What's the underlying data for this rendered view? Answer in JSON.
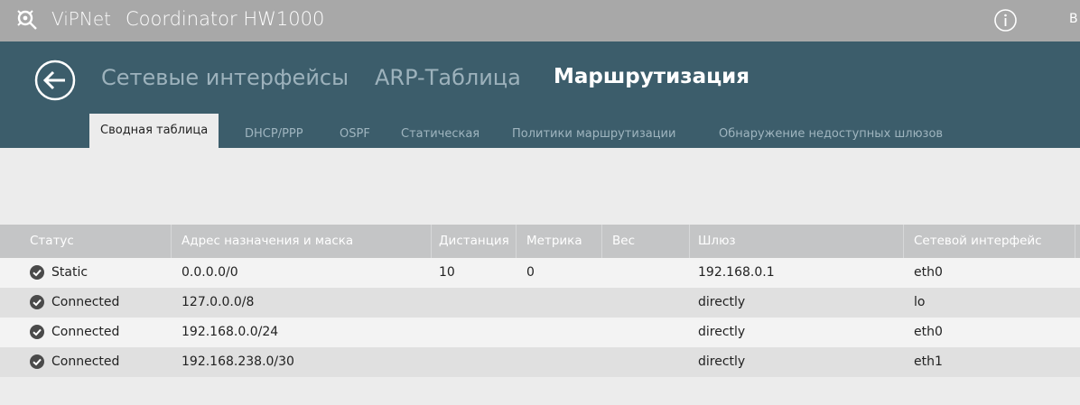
{
  "app": {
    "brand": "ViPNet",
    "product": "Coordinator HW1000",
    "user_initial": "B"
  },
  "header": {
    "main_tabs": [
      {
        "label": "Сетевые интерфейсы"
      },
      {
        "label": "ARP-Таблица"
      },
      {
        "label": "Маршрутизация"
      }
    ],
    "active_main_tab": "Маршрутизация",
    "sub_tabs": [
      {
        "label": "Сводная таблица"
      },
      {
        "label": "DHCP/PPP"
      },
      {
        "label": "OSPF"
      },
      {
        "label": "Статическая"
      },
      {
        "label": "Политики маршрутизации"
      },
      {
        "label": "Обнаружение недоступных шлюзов"
      }
    ],
    "active_sub_tab": "Сводная таблица"
  },
  "table": {
    "columns": [
      "Статус",
      "Адрес назначения и маска",
      "Дистанция",
      "Метрика",
      "Вес",
      "Шлюз",
      "Сетевой интерфейс"
    ],
    "rows": [
      {
        "status": "Static",
        "destination": "0.0.0.0/0",
        "distance": "10",
        "metric": "0",
        "weight": "",
        "gateway": "192.168.0.1",
        "interface": "eth0"
      },
      {
        "status": "Connected",
        "destination": "127.0.0.0/8",
        "distance": "",
        "metric": "",
        "weight": "",
        "gateway": "directly",
        "interface": "lo"
      },
      {
        "status": "Connected",
        "destination": "192.168.0.0/24",
        "distance": "",
        "metric": "",
        "weight": "",
        "gateway": "directly",
        "interface": "eth0"
      },
      {
        "status": "Connected",
        "destination": "192.168.238.0/30",
        "distance": "",
        "metric": "",
        "weight": "",
        "gateway": "directly",
        "interface": "eth1"
      }
    ]
  },
  "colors": {
    "header_bg": "#3c5d6b",
    "topbar_bg": "#a8a8a8",
    "table_header_bg": "#c4c5c6",
    "accent": "#ffffff"
  }
}
